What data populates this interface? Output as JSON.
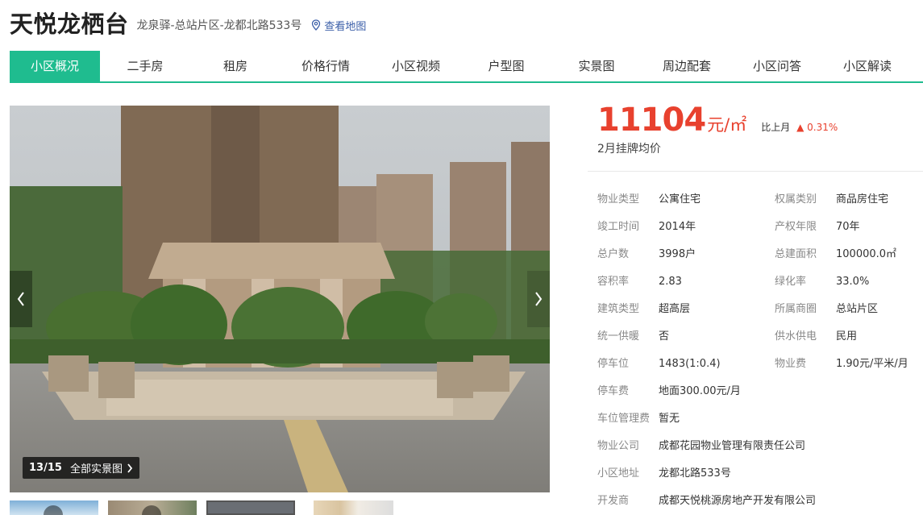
{
  "header": {
    "title": "天悦龙栖台",
    "address": "龙泉驿-总站片区-龙都北路533号",
    "map_link": "查看地图"
  },
  "nav": {
    "items": [
      "小区概况",
      "二手房",
      "租房",
      "价格行情",
      "小区视频",
      "户型图",
      "实景图",
      "周边配套",
      "小区问答",
      "小区解读"
    ],
    "active_index": 0
  },
  "gallery": {
    "counter": "13/15",
    "all_label": "全部实景图",
    "thumbnail_count": 4
  },
  "price": {
    "value": "11104",
    "unit": "元/㎡",
    "compare_label": "比上月",
    "change": "0.31%",
    "change_direction": "up",
    "label": "2月挂牌均价"
  },
  "info_left": [
    {
      "key": "物业类型",
      "value": "公寓住宅"
    },
    {
      "key": "竣工时间",
      "value": "2014年"
    },
    {
      "key": "总户数",
      "value": "3998户"
    },
    {
      "key": "容积率",
      "value": "2.83"
    },
    {
      "key": "建筑类型",
      "value": "超高层"
    },
    {
      "key": "统一供暖",
      "value": "否"
    },
    {
      "key": "停车位",
      "value": "1483(1:0.4)"
    },
    {
      "key": "停车费",
      "value": "地面300.00元/月"
    },
    {
      "key": "车位管理费",
      "value": "暂无"
    },
    {
      "key": "物业公司",
      "value": "成都花园物业管理有限责任公司"
    },
    {
      "key": "小区地址",
      "value": "龙都北路533号"
    },
    {
      "key": "开发商",
      "value": "成都天悦桃源房地产开发有限公司"
    }
  ],
  "info_right": [
    {
      "key": "权属类别",
      "value": "商品房住宅"
    },
    {
      "key": "产权年限",
      "value": "70年"
    },
    {
      "key": "总建面积",
      "value": "100000.0㎡"
    },
    {
      "key": "绿化率",
      "value": "33.0%"
    },
    {
      "key": "所属商圈",
      "value": "总站片区"
    },
    {
      "key": "供水供电",
      "value": "民用"
    },
    {
      "key": "物业费",
      "value": "1.90元/平米/月"
    }
  ],
  "colors": {
    "accent_green": "#1fbc8f",
    "price_red": "#e8412e",
    "link_blue": "#3a5ea8"
  },
  "icons": [
    "location-pin-icon",
    "chevron-left-icon",
    "chevron-right-icon",
    "chevron-right-small-icon",
    "play-icon"
  ]
}
